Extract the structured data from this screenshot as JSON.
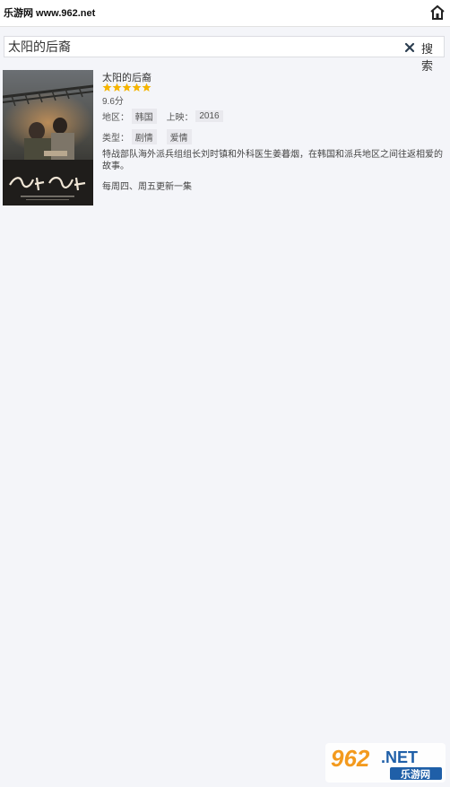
{
  "header": {
    "site_label": "乐游网 www.962.net",
    "home_icon": "home-icon"
  },
  "search": {
    "query": "太阳的后裔",
    "clear_icon": "close-icon",
    "button_label": "搜索"
  },
  "result": {
    "title": "太阳的后裔",
    "rating_stars": 5,
    "score": "9.6分",
    "region_label": "地区：",
    "region": "韩国",
    "release_label": "上映：",
    "release_year": "2016",
    "genre_label": "类型：",
    "genres": [
      "剧情",
      "爱情"
    ],
    "description": "特战部队海外派兵组组长刘时镇和外科医生姜暮烟，在韩国和派兵地区之间往返相爱的故事。",
    "schedule": "每周四、周五更新一集",
    "poster_icon": "movie-poster"
  },
  "watermark": {
    "text_big": "962.NET",
    "text_small": "乐游网",
    "colors": {
      "orange": "#f39a1e",
      "blue": "#1f5fa8"
    }
  }
}
